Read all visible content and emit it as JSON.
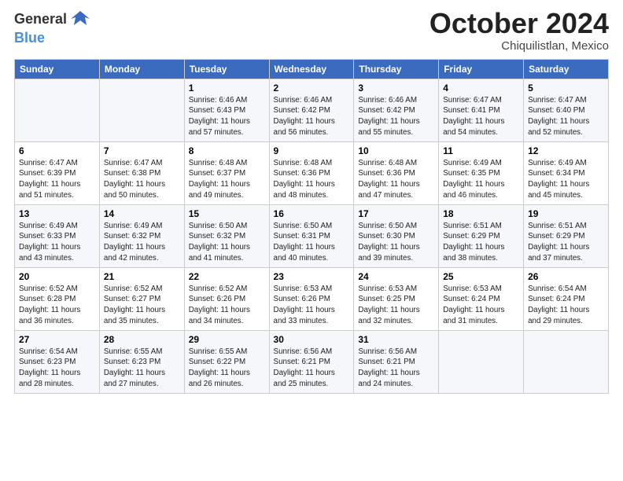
{
  "header": {
    "logo_general": "General",
    "logo_blue": "Blue",
    "month_title": "October 2024",
    "location": "Chiquilistlan, Mexico"
  },
  "weekdays": [
    "Sunday",
    "Monday",
    "Tuesday",
    "Wednesday",
    "Thursday",
    "Friday",
    "Saturday"
  ],
  "weeks": [
    [
      {
        "day": "",
        "sunrise": "",
        "sunset": "",
        "daylight": ""
      },
      {
        "day": "",
        "sunrise": "",
        "sunset": "",
        "daylight": ""
      },
      {
        "day": "1",
        "sunrise": "Sunrise: 6:46 AM",
        "sunset": "Sunset: 6:43 PM",
        "daylight": "Daylight: 11 hours and 57 minutes."
      },
      {
        "day": "2",
        "sunrise": "Sunrise: 6:46 AM",
        "sunset": "Sunset: 6:42 PM",
        "daylight": "Daylight: 11 hours and 56 minutes."
      },
      {
        "day": "3",
        "sunrise": "Sunrise: 6:46 AM",
        "sunset": "Sunset: 6:42 PM",
        "daylight": "Daylight: 11 hours and 55 minutes."
      },
      {
        "day": "4",
        "sunrise": "Sunrise: 6:47 AM",
        "sunset": "Sunset: 6:41 PM",
        "daylight": "Daylight: 11 hours and 54 minutes."
      },
      {
        "day": "5",
        "sunrise": "Sunrise: 6:47 AM",
        "sunset": "Sunset: 6:40 PM",
        "daylight": "Daylight: 11 hours and 52 minutes."
      }
    ],
    [
      {
        "day": "6",
        "sunrise": "Sunrise: 6:47 AM",
        "sunset": "Sunset: 6:39 PM",
        "daylight": "Daylight: 11 hours and 51 minutes."
      },
      {
        "day": "7",
        "sunrise": "Sunrise: 6:47 AM",
        "sunset": "Sunset: 6:38 PM",
        "daylight": "Daylight: 11 hours and 50 minutes."
      },
      {
        "day": "8",
        "sunrise": "Sunrise: 6:48 AM",
        "sunset": "Sunset: 6:37 PM",
        "daylight": "Daylight: 11 hours and 49 minutes."
      },
      {
        "day": "9",
        "sunrise": "Sunrise: 6:48 AM",
        "sunset": "Sunset: 6:36 PM",
        "daylight": "Daylight: 11 hours and 48 minutes."
      },
      {
        "day": "10",
        "sunrise": "Sunrise: 6:48 AM",
        "sunset": "Sunset: 6:36 PM",
        "daylight": "Daylight: 11 hours and 47 minutes."
      },
      {
        "day": "11",
        "sunrise": "Sunrise: 6:49 AM",
        "sunset": "Sunset: 6:35 PM",
        "daylight": "Daylight: 11 hours and 46 minutes."
      },
      {
        "day": "12",
        "sunrise": "Sunrise: 6:49 AM",
        "sunset": "Sunset: 6:34 PM",
        "daylight": "Daylight: 11 hours and 45 minutes."
      }
    ],
    [
      {
        "day": "13",
        "sunrise": "Sunrise: 6:49 AM",
        "sunset": "Sunset: 6:33 PM",
        "daylight": "Daylight: 11 hours and 43 minutes."
      },
      {
        "day": "14",
        "sunrise": "Sunrise: 6:49 AM",
        "sunset": "Sunset: 6:32 PM",
        "daylight": "Daylight: 11 hours and 42 minutes."
      },
      {
        "day": "15",
        "sunrise": "Sunrise: 6:50 AM",
        "sunset": "Sunset: 6:32 PM",
        "daylight": "Daylight: 11 hours and 41 minutes."
      },
      {
        "day": "16",
        "sunrise": "Sunrise: 6:50 AM",
        "sunset": "Sunset: 6:31 PM",
        "daylight": "Daylight: 11 hours and 40 minutes."
      },
      {
        "day": "17",
        "sunrise": "Sunrise: 6:50 AM",
        "sunset": "Sunset: 6:30 PM",
        "daylight": "Daylight: 11 hours and 39 minutes."
      },
      {
        "day": "18",
        "sunrise": "Sunrise: 6:51 AM",
        "sunset": "Sunset: 6:29 PM",
        "daylight": "Daylight: 11 hours and 38 minutes."
      },
      {
        "day": "19",
        "sunrise": "Sunrise: 6:51 AM",
        "sunset": "Sunset: 6:29 PM",
        "daylight": "Daylight: 11 hours and 37 minutes."
      }
    ],
    [
      {
        "day": "20",
        "sunrise": "Sunrise: 6:52 AM",
        "sunset": "Sunset: 6:28 PM",
        "daylight": "Daylight: 11 hours and 36 minutes."
      },
      {
        "day": "21",
        "sunrise": "Sunrise: 6:52 AM",
        "sunset": "Sunset: 6:27 PM",
        "daylight": "Daylight: 11 hours and 35 minutes."
      },
      {
        "day": "22",
        "sunrise": "Sunrise: 6:52 AM",
        "sunset": "Sunset: 6:26 PM",
        "daylight": "Daylight: 11 hours and 34 minutes."
      },
      {
        "day": "23",
        "sunrise": "Sunrise: 6:53 AM",
        "sunset": "Sunset: 6:26 PM",
        "daylight": "Daylight: 11 hours and 33 minutes."
      },
      {
        "day": "24",
        "sunrise": "Sunrise: 6:53 AM",
        "sunset": "Sunset: 6:25 PM",
        "daylight": "Daylight: 11 hours and 32 minutes."
      },
      {
        "day": "25",
        "sunrise": "Sunrise: 6:53 AM",
        "sunset": "Sunset: 6:24 PM",
        "daylight": "Daylight: 11 hours and 31 minutes."
      },
      {
        "day": "26",
        "sunrise": "Sunrise: 6:54 AM",
        "sunset": "Sunset: 6:24 PM",
        "daylight": "Daylight: 11 hours and 29 minutes."
      }
    ],
    [
      {
        "day": "27",
        "sunrise": "Sunrise: 6:54 AM",
        "sunset": "Sunset: 6:23 PM",
        "daylight": "Daylight: 11 hours and 28 minutes."
      },
      {
        "day": "28",
        "sunrise": "Sunrise: 6:55 AM",
        "sunset": "Sunset: 6:23 PM",
        "daylight": "Daylight: 11 hours and 27 minutes."
      },
      {
        "day": "29",
        "sunrise": "Sunrise: 6:55 AM",
        "sunset": "Sunset: 6:22 PM",
        "daylight": "Daylight: 11 hours and 26 minutes."
      },
      {
        "day": "30",
        "sunrise": "Sunrise: 6:56 AM",
        "sunset": "Sunset: 6:21 PM",
        "daylight": "Daylight: 11 hours and 25 minutes."
      },
      {
        "day": "31",
        "sunrise": "Sunrise: 6:56 AM",
        "sunset": "Sunset: 6:21 PM",
        "daylight": "Daylight: 11 hours and 24 minutes."
      },
      {
        "day": "",
        "sunrise": "",
        "sunset": "",
        "daylight": ""
      },
      {
        "day": "",
        "sunrise": "",
        "sunset": "",
        "daylight": ""
      }
    ]
  ]
}
